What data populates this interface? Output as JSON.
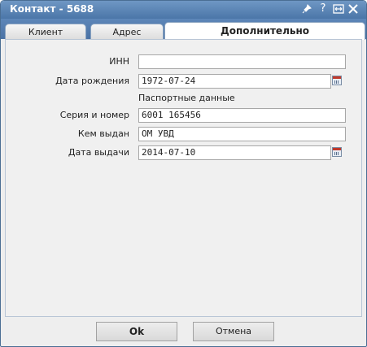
{
  "window": {
    "title": "Контакт - 5688",
    "icons": [
      "pin-icon",
      "help-icon",
      "resize-icon",
      "close-icon"
    ]
  },
  "tabs": [
    {
      "label": "Клиент",
      "active": false
    },
    {
      "label": "Адрес",
      "active": false
    },
    {
      "label": "Дополнительно",
      "active": true
    }
  ],
  "form": {
    "inn": {
      "label": "ИНН",
      "value": ""
    },
    "birth_date": {
      "label": "Дата рождения",
      "value": "1972-07-24"
    },
    "passport_heading": "Паспортные данные",
    "series_number": {
      "label": "Серия и номер",
      "value": "6001 165456"
    },
    "issued_by": {
      "label": "Кем выдан",
      "value": "ОМ УВД"
    },
    "issue_date": {
      "label": "Дата выдачи",
      "value": "2014-07-10"
    }
  },
  "buttons": {
    "ok": "Ok",
    "cancel": "Отмена"
  }
}
